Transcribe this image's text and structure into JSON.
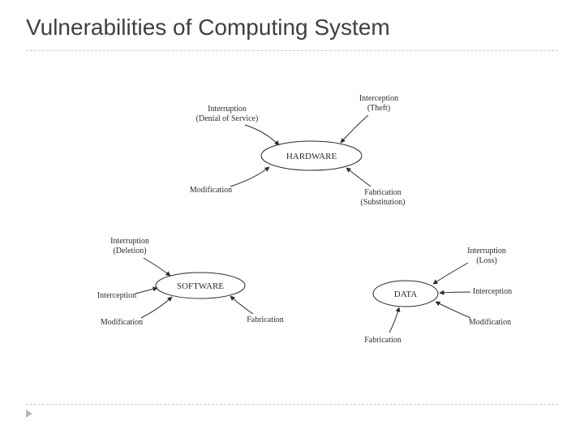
{
  "title": "Vulnerabilities of Computing System",
  "nodes": {
    "hardware": "HARDWARE",
    "software": "SOFTWARE",
    "data": "DATA"
  },
  "annotations": {
    "hw_interruption_l1": "Interruption",
    "hw_interruption_l2": "(Denial of Service)",
    "hw_interception_l1": "Interception",
    "hw_interception_l2": "(Theft)",
    "hw_modification": "Modification",
    "hw_fabrication_l1": "Fabrication",
    "hw_fabrication_l2": "(Substitution)",
    "sw_interruption_l1": "Interruption",
    "sw_interruption_l2": "(Deletion)",
    "sw_interception": "Interception",
    "sw_modification": "Modification",
    "sw_fabrication": "Fabrication",
    "data_interruption_l1": "Interruption",
    "data_interruption_l2": "(Loss)",
    "data_interception": "Interception",
    "data_modification": "Modification",
    "data_fabrication": "Fabrication"
  }
}
